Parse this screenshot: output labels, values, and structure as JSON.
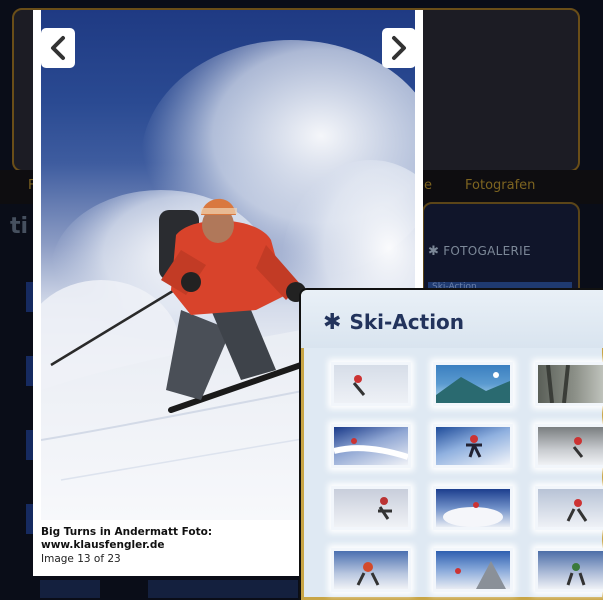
{
  "background_page": {
    "nav_items": [
      "F",
      "e",
      "Fotografen"
    ],
    "heading_fragment": "ti",
    "sidebar_title": "FOTOGALERIE",
    "sidebar_link": "Ski-Action"
  },
  "lightbox": {
    "caption_line1": "Big Turns in Andermatt Foto:",
    "caption_line2": "www.klausfengler.de",
    "counter": "Image 13 of 23",
    "prev_icon": "chevron-left-icon",
    "next_icon": "chevron-right-icon"
  },
  "gallery": {
    "title": "Ski-Action",
    "title_icon": "asterisk-icon",
    "thumbnails": [
      {
        "label": "thumb-1"
      },
      {
        "label": "thumb-2"
      },
      {
        "label": "thumb-3"
      },
      {
        "label": "thumb-4"
      },
      {
        "label": "thumb-5"
      },
      {
        "label": "thumb-6"
      },
      {
        "label": "thumb-7"
      },
      {
        "label": "thumb-8"
      },
      {
        "label": "thumb-9"
      },
      {
        "label": "thumb-10"
      },
      {
        "label": "thumb-11"
      },
      {
        "label": "thumb-12"
      }
    ]
  },
  "colors": {
    "accent_gold": "#c8a546",
    "nav_text": "#7d6420",
    "gallery_title": "#22335c"
  }
}
